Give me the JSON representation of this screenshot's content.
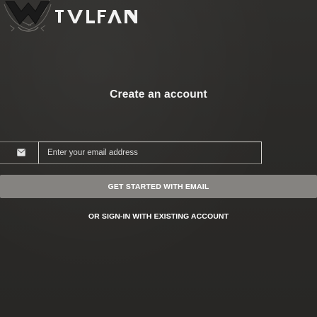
{
  "heading": "Create an account",
  "email": {
    "value": "",
    "placeholder": "Enter your email address"
  },
  "primary_button_label": "GET STARTED WITH EMAIL",
  "secondary_link_label": "OR SIGN-IN WITH EXISTING ACCOUNT",
  "icons": {
    "email": "envelope-icon",
    "logo": "brand-logo"
  },
  "colors": {
    "background": "#2d2c2a",
    "button": "#858380",
    "input_border": "#d8d6d2",
    "text": "#ffffff"
  }
}
